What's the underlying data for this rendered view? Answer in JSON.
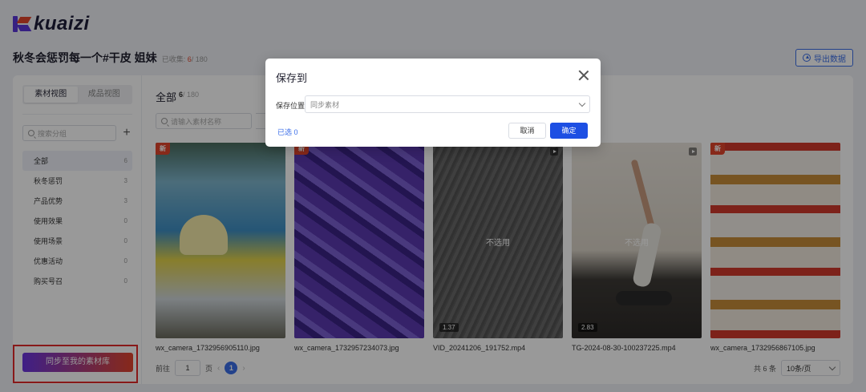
{
  "app": {
    "logo_text": "kuaizi"
  },
  "header": {
    "title": "秋冬会惩罚每一个#干皮 姐妹",
    "collected_label": "已收集:",
    "collected_count": "6",
    "collected_total": "/ 180",
    "export_label": "导出数据"
  },
  "sidebar": {
    "view_tabs": [
      {
        "label": "素材视图",
        "active": true
      },
      {
        "label": "成品视图",
        "active": false
      }
    ],
    "search_placeholder": "搜索分组",
    "groups": [
      {
        "label": "全部",
        "count": "6"
      },
      {
        "label": "秋冬惩罚",
        "count": "3"
      },
      {
        "label": "产品优势",
        "count": "3"
      },
      {
        "label": "使用效果",
        "count": "0"
      },
      {
        "label": "使用场景",
        "count": "0"
      },
      {
        "label": "优惠活动",
        "count": "0"
      },
      {
        "label": "购买号召",
        "count": "0"
      }
    ],
    "sync_button": "同步至我的素材库"
  },
  "content": {
    "title": "全部",
    "count": "6",
    "total": "/ 180",
    "search_placeholder": "请输入素材名称",
    "items": [
      {
        "filename": "wx_camera_1732956905110.jpg",
        "badge": "新",
        "overlay": "",
        "duration": ""
      },
      {
        "filename": "wx_camera_1732957234073.jpg",
        "badge": "新",
        "overlay": "",
        "duration": ""
      },
      {
        "filename": "VID_20241206_191752.mp4",
        "badge": "",
        "overlay": "不选用",
        "duration": "1.37"
      },
      {
        "filename": "TG-2024-08-30-100237225.mp4",
        "badge": "",
        "overlay": "不选用",
        "duration": "2.83"
      },
      {
        "filename": "wx_camera_1732956867105.jpg",
        "badge": "新",
        "overlay": "",
        "duration": ""
      }
    ],
    "pagination": {
      "goto_label": "前往",
      "goto_value": "1",
      "page_suffix": "页",
      "prev": "‹",
      "current": "1",
      "next": "›",
      "total_label": "共 6 条",
      "per_page": "10条/页"
    }
  },
  "modal": {
    "title": "保存到",
    "field_label": "保存位置",
    "field_placeholder": "同步素材",
    "selected_label": "已选 0",
    "cancel_label": "取消",
    "ok_label": "确定"
  },
  "colors": {
    "primary": "#1d4fe3",
    "accent_red": "#e2452c",
    "brand_purple": "#5a36d9",
    "highlight_border": "#e32a2a"
  }
}
